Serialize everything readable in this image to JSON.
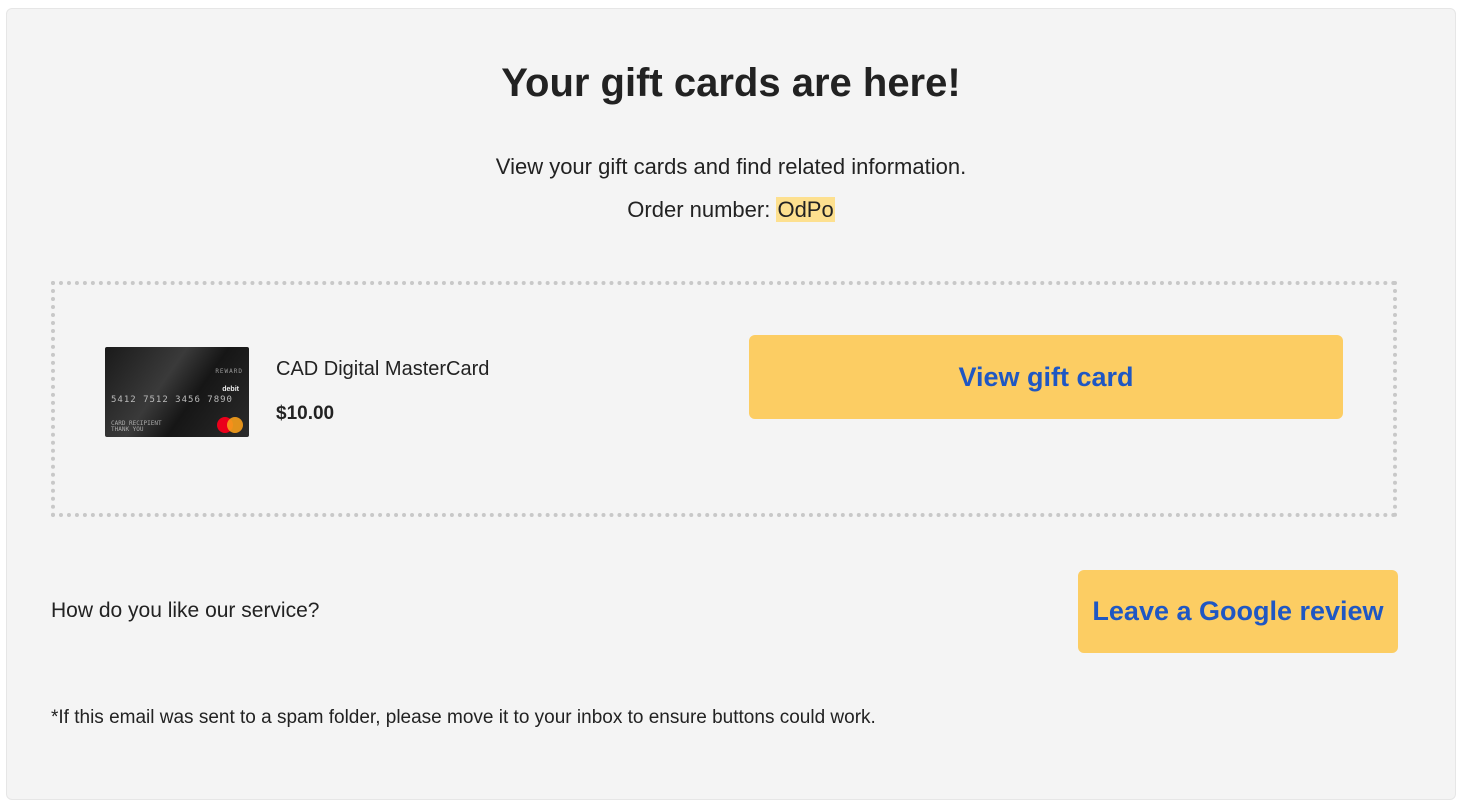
{
  "header": {
    "title": "Your gift cards are here!",
    "subtitle": "View your gift cards and find related information.",
    "order_label": "Order number: ",
    "order_number": "OdPo"
  },
  "gift_card": {
    "image": {
      "icon": "mastercard-card-image",
      "brand_text": "REWARD",
      "number_text": "5412 7512 3456 7890",
      "type_text": "debit",
      "recipient_text": "CARD RECIPIENT",
      "thanks_text": "THANK YOU"
    },
    "name": "CAD Digital MasterCard",
    "amount": "$10.00",
    "view_button_label": "View gift card"
  },
  "review": {
    "question": "How do you like our service?",
    "button_label": "Leave a Google review"
  },
  "footnote": "*If this email was sent to a spam folder, please move it to your inbox to ensure buttons could work.",
  "colors": {
    "background": "#f4f4f4",
    "button_bg": "#fccd63",
    "button_text": "#1f57c3",
    "highlight": "#fde08f",
    "dotted_border": "#c8c8c8"
  }
}
